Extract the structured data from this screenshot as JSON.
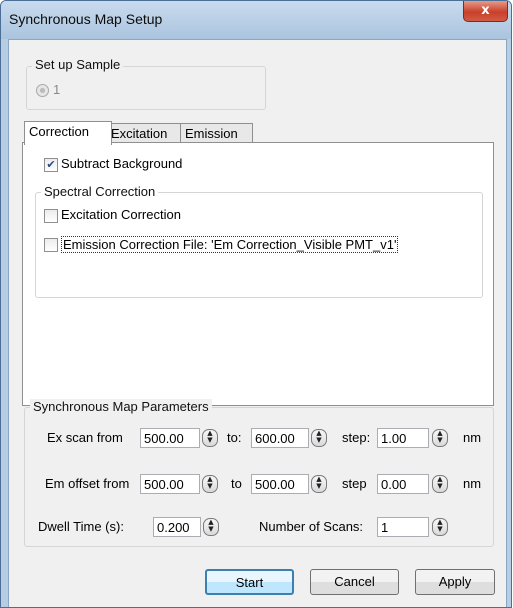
{
  "window": {
    "title": "Synchronous Map Setup",
    "close_glyph": "x"
  },
  "setup_sample": {
    "label": "Set up Sample",
    "option": "1"
  },
  "tabs": [
    {
      "label": "Correction"
    },
    {
      "label": "Excitation"
    },
    {
      "label": "Emission"
    }
  ],
  "correction": {
    "subtract_background": {
      "label": "Subtract Background",
      "checked": true
    },
    "spectral_group_label": "Spectral Correction",
    "excitation": {
      "label": "Excitation Correction",
      "checked": false
    },
    "emission": {
      "label": "Emission Correction File: 'Em Correction_Visible PMT_v1'",
      "checked": false
    }
  },
  "params": {
    "group_label": "Synchronous Map Parameters",
    "ex_scan": {
      "label": "Ex scan from",
      "from": "500.00",
      "to_label": "to:",
      "to": "600.00",
      "step_label": "step:",
      "step": "1.00",
      "unit": "nm"
    },
    "em_offset": {
      "label": "Em offset from",
      "from": "500.00",
      "to_label": "to",
      "to": "500.00",
      "step_label": "step",
      "step": "0.00",
      "unit": "nm"
    },
    "dwell": {
      "label": "Dwell Time (s):",
      "value": "0.200"
    },
    "scans": {
      "label": "Number of Scans:",
      "value": "1"
    }
  },
  "buttons": {
    "start": "Start",
    "cancel": "Cancel",
    "apply": "Apply"
  }
}
